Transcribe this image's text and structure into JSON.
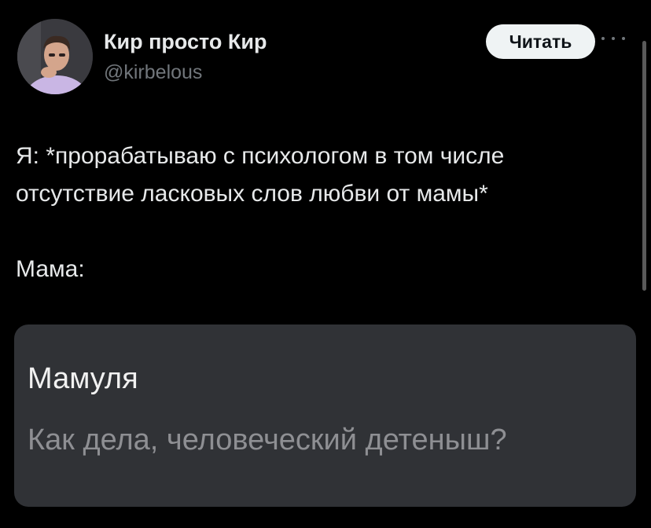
{
  "author": {
    "name": "Кир просто Кир",
    "handle": "@kirbelous"
  },
  "header": {
    "read_button_label": "Читать",
    "more_icon": "more-horizontal-icon"
  },
  "tweet": {
    "paragraphs": [
      "Я: *прорабатываю с психологом в том числе отсутствие ласковых слов любви от мамы*",
      "Мама:"
    ]
  },
  "embedded_screenshot": {
    "contact_name": "Мамуля",
    "message_preview": "Как дела, человеческий детеныш?"
  },
  "colors": {
    "background": "#000000",
    "primary_text": "#e7e9ea",
    "secondary_text": "#71767b",
    "button_bg": "#eff3f4",
    "card_bg": "#303236"
  }
}
